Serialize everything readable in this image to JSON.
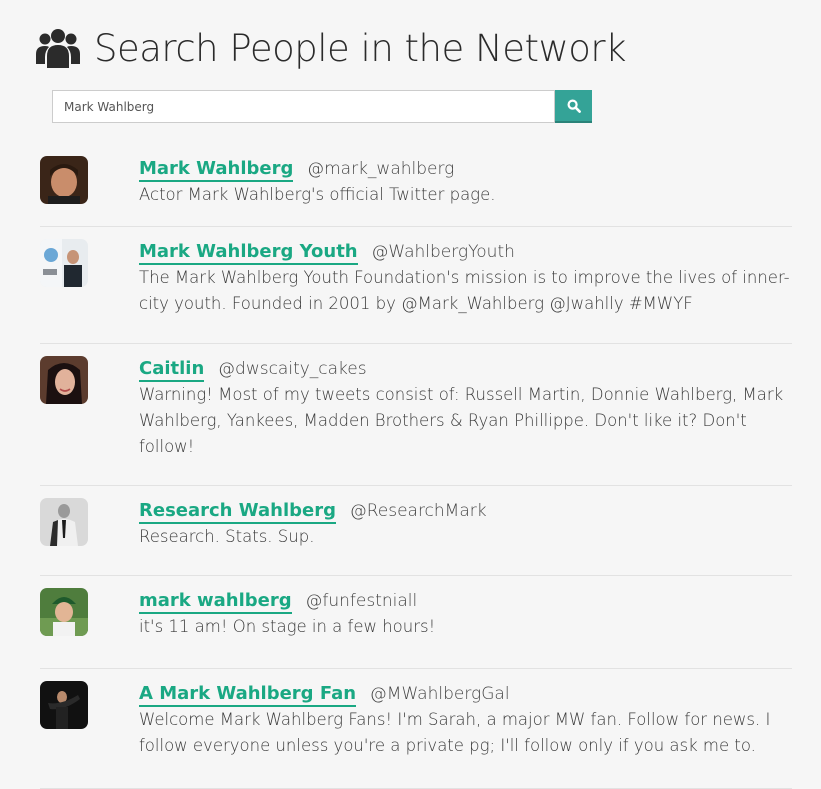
{
  "header": {
    "title": "Search People in the Network",
    "icon": "people-icon"
  },
  "search": {
    "value": "Mark Wahlberg",
    "button_icon": "search-icon",
    "accent": "#34a397"
  },
  "results": [
    {
      "name": "Mark Wahlberg",
      "handle": "@mark_wahlberg",
      "bio": "Actor Mark Wahlberg's official Twitter page."
    },
    {
      "name": "Mark Wahlberg Youth",
      "handle": "@WahlbergYouth",
      "bio": "The Mark Wahlberg Youth Foundation's mission is to improve the lives of inner-city youth. Founded in 2001 by @Mark_Wahlberg @Jwahlly #MWYF"
    },
    {
      "name": "Caitlin",
      "handle": "@dwscaity_cakes",
      "bio": "Warning! Most of my tweets consist of: Russell Martin, Donnie Wahlberg, Mark Wahlberg, Yankees, Madden Brothers & Ryan Phillippe. Don't like it? Don't follow!"
    },
    {
      "name": "Research Wahlberg",
      "handle": "@ResearchMark",
      "bio": "Research. Stats. Sup."
    },
    {
      "name": "mark wahlberg",
      "handle": "@funfestniall",
      "bio": "it's 11 am! On stage in a few hours!"
    },
    {
      "name": "A Mark Wahlberg Fan",
      "handle": "@MWahlbergGal",
      "bio": "Welcome Mark Wahlberg Fans! I'm Sarah, a major MW fan. Follow for news. I follow everyone unless you're a private pg; I'll follow only if you ask me to."
    }
  ],
  "colors": {
    "link": "#1aa883",
    "background": "#f6f6f6"
  }
}
